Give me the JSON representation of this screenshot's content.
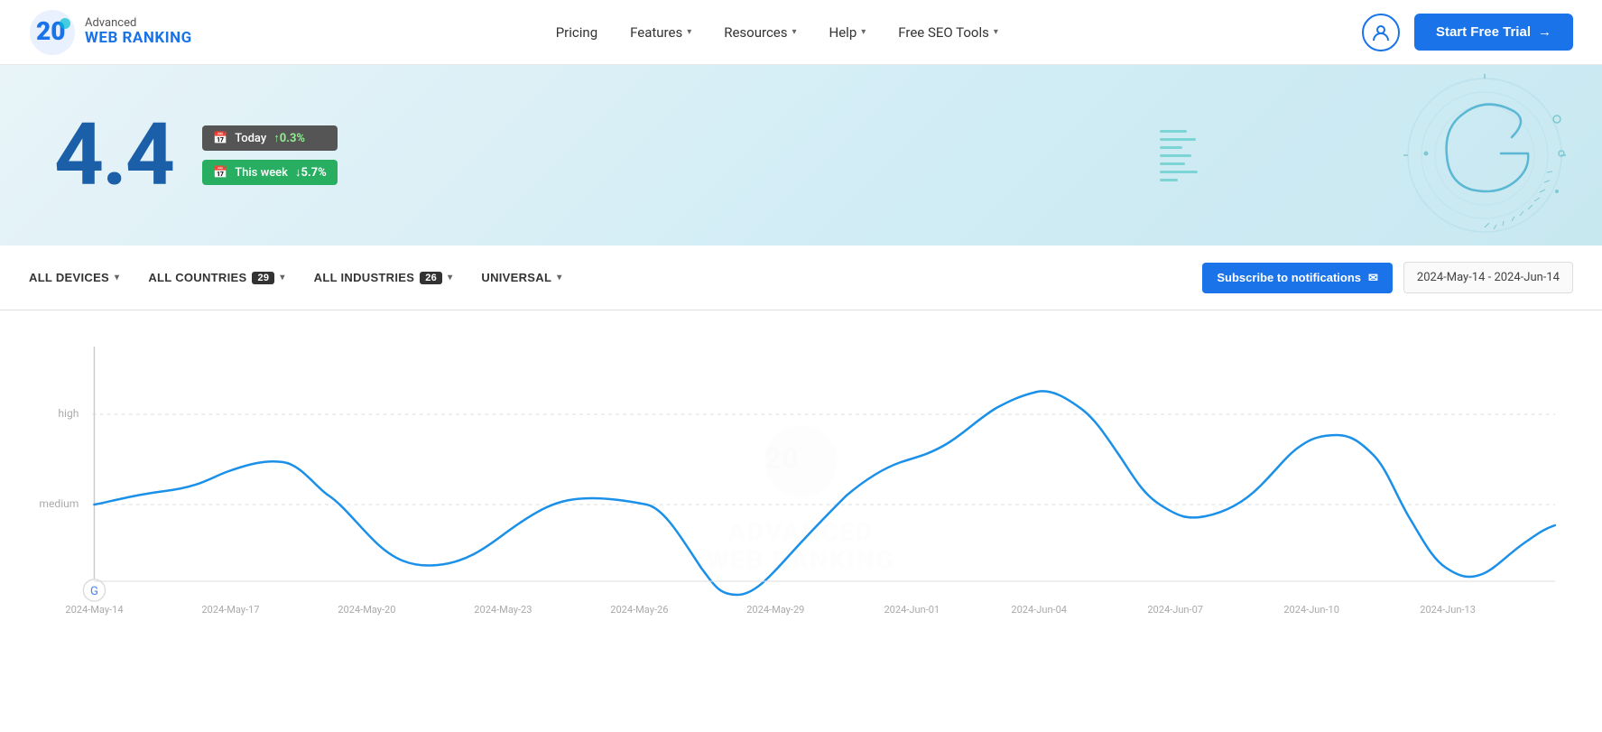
{
  "nav": {
    "logo_advanced": "Advanced",
    "logo_awr": "WEB RANKING",
    "links": [
      {
        "label": "Pricing",
        "hasDropdown": false
      },
      {
        "label": "Features",
        "hasDropdown": true
      },
      {
        "label": "Resources",
        "hasDropdown": true
      },
      {
        "label": "Help",
        "hasDropdown": true
      },
      {
        "label": "Free SEO Tools",
        "hasDropdown": true
      }
    ],
    "start_trial": "Start Free Trial"
  },
  "hero": {
    "score": "4.4",
    "badge_today_label": "Today",
    "badge_today_change": "↑0.3%",
    "badge_week_label": "This week",
    "badge_week_change": "↓5.7%"
  },
  "filters": {
    "all_devices": "ALL DEVICES",
    "all_countries": "ALL COUNTRIES",
    "countries_count": "29",
    "all_industries": "ALL INDUSTRIES",
    "industries_count": "26",
    "universal": "UNIVERSAL",
    "subscribe_label": "Subscribe to notifications",
    "date_range": "2024-May-14 - 2024-Jun-14"
  },
  "chart": {
    "y_labels": [
      "high",
      "medium"
    ],
    "x_labels": [
      "2024-May-14",
      "2024-May-17",
      "2024-May-20",
      "2024-May-23",
      "2024-May-26",
      "2024-May-29",
      "2024-Jun-01",
      "2024-Jun-04",
      "2024-Jun-07",
      "2024-Jun-10",
      "2024-Jun-13"
    ],
    "watermark_line1": "Advanced",
    "watermark_line2": "WEB RANKING"
  }
}
